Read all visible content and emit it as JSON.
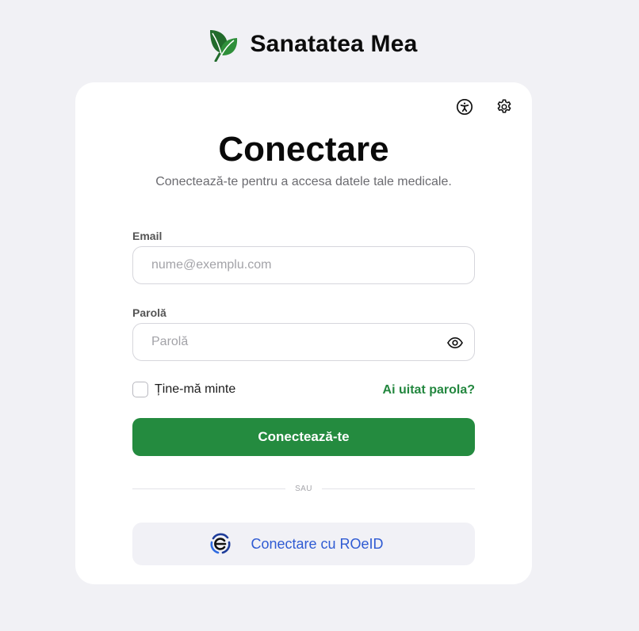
{
  "brand": {
    "name": "Sanatatea Mea",
    "logo_icon": "leaf-icon"
  },
  "top_icons": {
    "accessibility": "accessibility-icon",
    "settings": "gear-icon"
  },
  "login": {
    "title": "Conectare",
    "subtitle": "Conectează-te pentru a accesa datele tale medicale.",
    "email_label": "Email",
    "email_value": "",
    "email_placeholder": "nume@exemplu.com",
    "password_label": "Parolă",
    "password_value": "",
    "password_placeholder": "Parolă",
    "remember_label": "Ține-mă minte",
    "remember_checked": false,
    "forgot_label": "Ai uitat parola?",
    "submit_label": "Conectează-te",
    "divider_label": "SAU",
    "roeid_label": "Conectare cu ROeID"
  },
  "colors": {
    "background": "#f1f1f5",
    "primary_green": "#248b3f",
    "link_green": "#23873f",
    "roeid_blue": "#2f5bd3"
  }
}
